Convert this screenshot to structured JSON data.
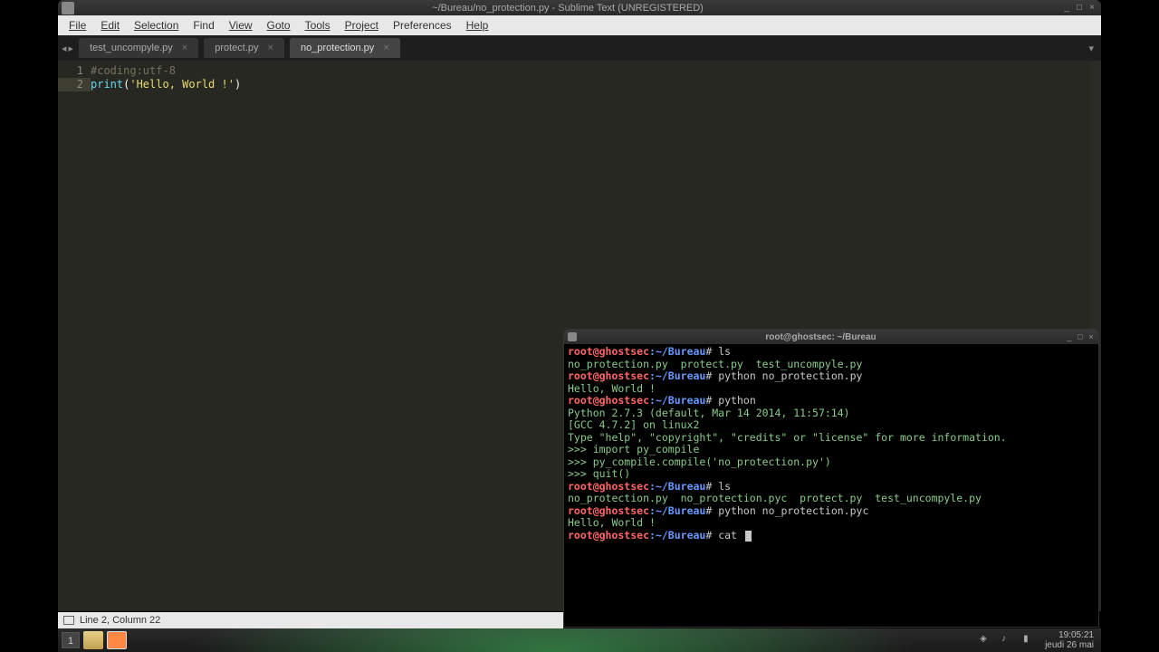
{
  "window": {
    "title": "~/Bureau/no_protection.py - Sublime Text (UNREGISTERED)"
  },
  "menu": {
    "file": "File",
    "edit": "Edit",
    "selection": "Selection",
    "find": "Find",
    "view": "View",
    "goto": "Goto",
    "tools": "Tools",
    "project": "Project",
    "preferences": "Preferences",
    "help": "Help"
  },
  "tabs": {
    "arrow_left": "◂",
    "arrow_right": "▸",
    "items": [
      {
        "label": "test_uncompyle.py",
        "close": "×"
      },
      {
        "label": "protect.py",
        "close": "×"
      },
      {
        "label": "no_protection.py",
        "close": "×"
      }
    ],
    "caret": "▾"
  },
  "editor": {
    "lines": [
      {
        "num": "1",
        "comment": "#coding:utf-8"
      },
      {
        "num": "2",
        "builtin": "print",
        "punct_open": "(",
        "string": "'Hello, World !'",
        "punct_close": ")"
      }
    ]
  },
  "status": {
    "text": "Line 2, Column 22"
  },
  "terminal": {
    "title": "root@ghostsec: ~/Bureau",
    "prompt_user": "root@ghostsec",
    "prompt_sep": ":",
    "prompt_path": "~/Bureau",
    "prompt_end": "# ",
    "lines": [
      {
        "type": "prompt",
        "cmd": "ls"
      },
      {
        "type": "out",
        "text": "no_protection.py  protect.py  test_uncompyle.py"
      },
      {
        "type": "prompt",
        "cmd": "python no_protection.py"
      },
      {
        "type": "out",
        "text": "Hello, World !"
      },
      {
        "type": "prompt",
        "cmd": "python"
      },
      {
        "type": "out",
        "text": "Python 2.7.3 (default, Mar 14 2014, 11:57:14)"
      },
      {
        "type": "out",
        "text": "[GCC 4.7.2] on linux2"
      },
      {
        "type": "out",
        "text": "Type \"help\", \"copyright\", \"credits\" or \"license\" for more information."
      },
      {
        "type": "out",
        "text": ">>> import py_compile"
      },
      {
        "type": "out",
        "text": ">>> py_compile.compile('no_protection.py')"
      },
      {
        "type": "out",
        "text": ">>> quit()"
      },
      {
        "type": "prompt",
        "cmd": "ls"
      },
      {
        "type": "out",
        "text": "no_protection.py  no_protection.pyc  protect.py  test_uncompyle.py"
      },
      {
        "type": "prompt",
        "cmd": "python no_protection.pyc"
      },
      {
        "type": "out",
        "text": "Hello, World !"
      },
      {
        "type": "prompt",
        "cmd": "cat ",
        "cursor": true
      }
    ]
  },
  "taskbar": {
    "workspace": "1",
    "time": "19:05:21",
    "date": "jeudi 26 mai"
  }
}
